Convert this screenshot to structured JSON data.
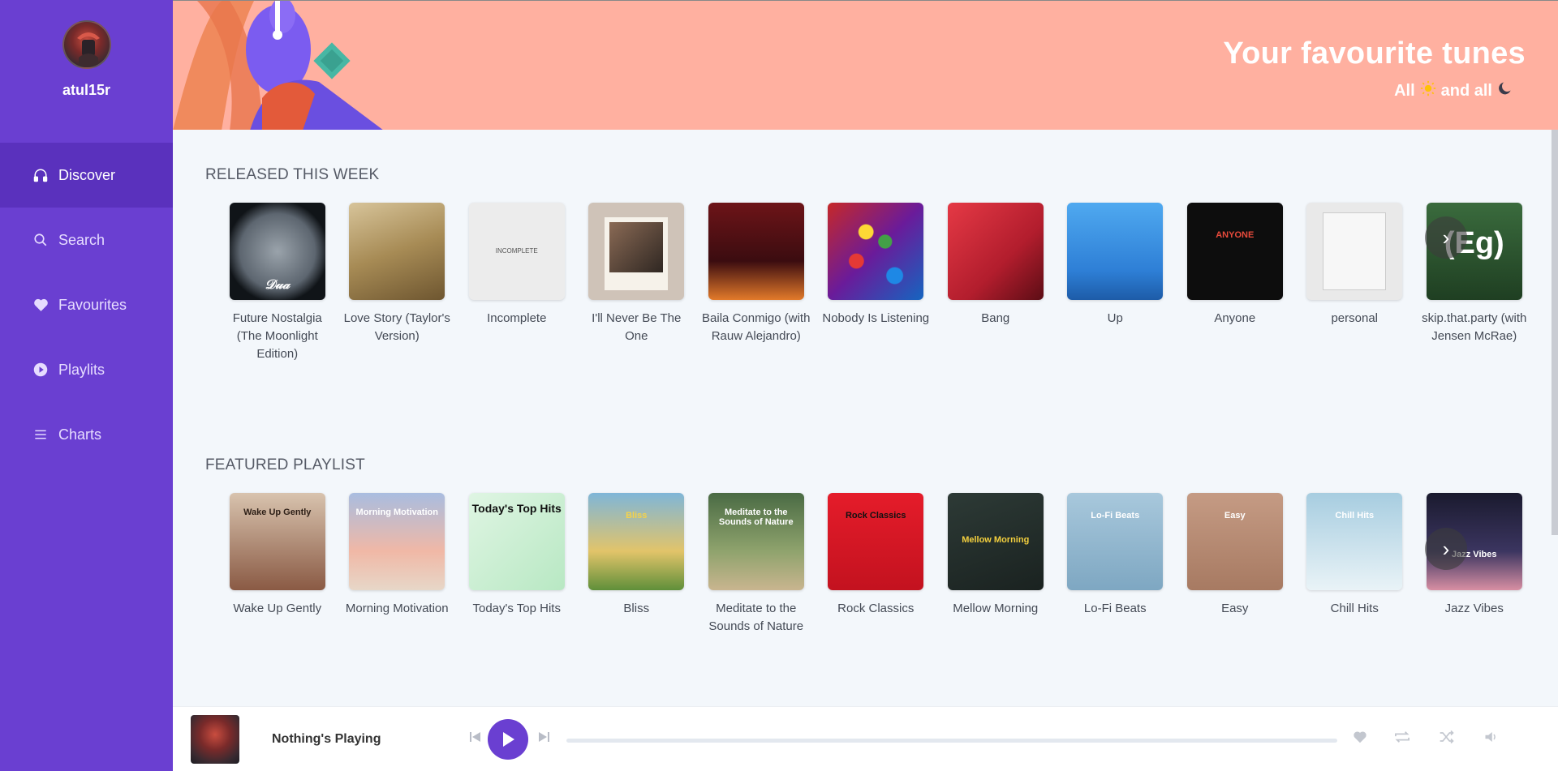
{
  "user": {
    "name": "atul15r"
  },
  "nav": [
    {
      "label": "Discover",
      "icon": "headphones-icon",
      "active": true
    },
    {
      "label": "Search",
      "icon": "search-icon",
      "active": false
    },
    {
      "label": "Favourites",
      "icon": "heart-icon",
      "active": false
    },
    {
      "label": "Playlits",
      "icon": "play-circle-icon",
      "active": false
    },
    {
      "label": "Charts",
      "icon": "list-icon",
      "active": false
    }
  ],
  "banner": {
    "title": "Your favourite tunes",
    "sub_pre": "All",
    "sub_mid": "and all"
  },
  "sections": {
    "released": {
      "title": "RELEASED THIS WEEK",
      "items": [
        {
          "label": "Future Nostalgia (The Moonlight Edition)"
        },
        {
          "label": "Love Story (Taylor's Version)"
        },
        {
          "label": "Incomplete"
        },
        {
          "label": "I'll Never Be The One"
        },
        {
          "label": "Baila Conmigo (with Rauw Alejandro)"
        },
        {
          "label": "Nobody Is Listening"
        },
        {
          "label": "Bang"
        },
        {
          "label": "Up"
        },
        {
          "label": "Anyone"
        },
        {
          "label": "personal"
        },
        {
          "label": "skip.that.party (with Jensen McRae)"
        }
      ]
    },
    "featured": {
      "title": "FEATURED PLAYLIST",
      "items": [
        {
          "label": "Wake Up Gently",
          "cover_text": "Wake Up Gently"
        },
        {
          "label": "Morning Motivation",
          "cover_text": "Morning Motivation"
        },
        {
          "label": "Today's Top Hits",
          "cover_text": "Today's Top Hits"
        },
        {
          "label": "Bliss",
          "cover_text": "Bliss"
        },
        {
          "label": "Meditate to the Sounds of Nature",
          "cover_text": "Meditate to the Sounds of Nature"
        },
        {
          "label": "Rock Classics",
          "cover_text": "Rock Classics"
        },
        {
          "label": "Mellow Morning",
          "cover_text": "Mellow Morning"
        },
        {
          "label": "Lo-Fi Beats",
          "cover_text": "Lo-Fi Beats"
        },
        {
          "label": "Easy",
          "cover_text": "Easy"
        },
        {
          "label": "Chill Hits",
          "cover_text": "Chill Hits"
        },
        {
          "label": "Jazz Vibes",
          "cover_text": "Jazz Vibes"
        }
      ]
    }
  },
  "player": {
    "now_playing": "Nothing's Playing",
    "progress": 0
  },
  "colors": {
    "accent": "#6a3fd1",
    "banner": "#ffb0a0",
    "background": "#f3f7fb"
  }
}
